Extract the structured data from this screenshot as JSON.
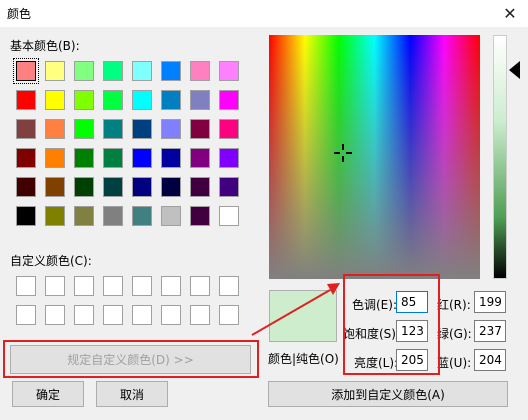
{
  "window": {
    "title": "颜色",
    "close_icon": "close-icon"
  },
  "basic_colors_label": "基本颜色(B):",
  "basic_colors": [
    [
      "#ff8080",
      "#ffff80",
      "#80ff80",
      "#00ff80",
      "#80ffff",
      "#0080ff",
      "#ff80c0",
      "#ff80ff"
    ],
    [
      "#ff0000",
      "#ffff00",
      "#80ff00",
      "#00ff40",
      "#00ffff",
      "#0080c0",
      "#8080c0",
      "#ff00ff"
    ],
    [
      "#804040",
      "#ff8040",
      "#00ff00",
      "#008080",
      "#004080",
      "#8080ff",
      "#800040",
      "#ff0080"
    ],
    [
      "#800000",
      "#ff8000",
      "#008000",
      "#008040",
      "#0000ff",
      "#0000a0",
      "#800080",
      "#8000ff"
    ],
    [
      "#400000",
      "#804000",
      "#004000",
      "#004040",
      "#000080",
      "#000040",
      "#400040",
      "#400080"
    ],
    [
      "#000000",
      "#808000",
      "#808040",
      "#808080",
      "#408080",
      "#c0c0c0",
      "#400040",
      "#ffffff"
    ]
  ],
  "custom_colors_label": "自定义颜色(C):",
  "define_custom_button": "规定自定义颜色(D) >>",
  "ok_button": "确定",
  "cancel_button": "取消",
  "color_solid_label": "颜色|纯色(O)",
  "hue_label": "色调(E):",
  "hue_value": "85",
  "sat_label": "饱和度(S):",
  "sat_value": "123",
  "lum_label": "亮度(L):",
  "lum_value": "205",
  "red_label": "红(R):",
  "red_value": "199",
  "green_label": "绿(G):",
  "green_value": "237",
  "blue_label": "蓝(U):",
  "blue_value": "204",
  "add_custom_button": "添加到自定义颜色(A)",
  "preview_color": "#cdedcc",
  "annotation_color": "#e02020"
}
